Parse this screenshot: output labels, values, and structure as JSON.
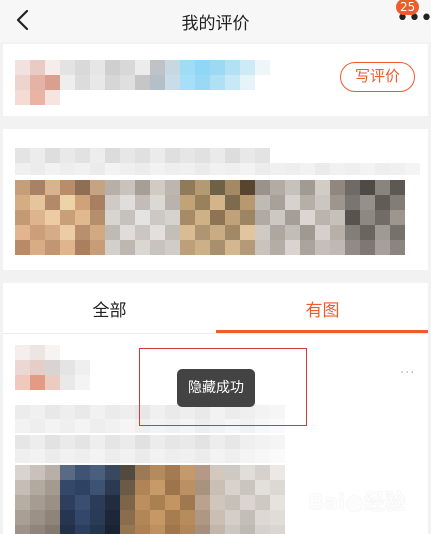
{
  "header": {
    "title": "我的评价",
    "badge_count": "25",
    "back_icon": "chevron-left-icon",
    "more_icon": "more-dots-icon"
  },
  "profile": {
    "write_review_label": "写评价"
  },
  "tabs": [
    {
      "label": "全部",
      "active": false
    },
    {
      "label": "有图",
      "active": true
    }
  ],
  "toast": {
    "message": "隐藏成功"
  },
  "review_item": {
    "more_label": "···"
  },
  "watermark": {
    "logo_text": "Bai●经验",
    "url": "jingyan.baidu.com"
  },
  "colors": {
    "accent": "#ef5b2b",
    "toast_bg": "#434343",
    "highlight_box": "#d23a3a"
  }
}
